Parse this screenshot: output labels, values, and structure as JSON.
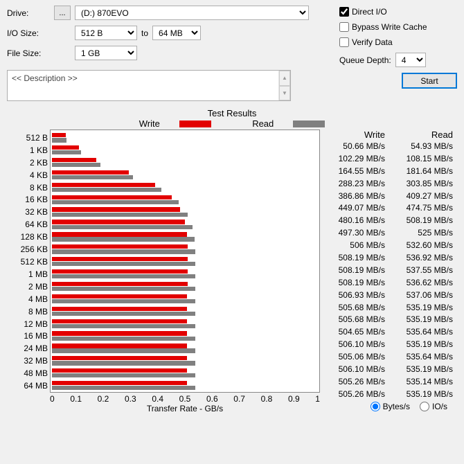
{
  "labels": {
    "drive": "Drive:",
    "iosize": "I/O Size:",
    "filesize": "File Size:",
    "to": "to",
    "direct_io": "Direct I/O",
    "bypass": "Bypass Write Cache",
    "verify": "Verify Data",
    "queue_depth": "Queue Depth:",
    "start": "Start",
    "description": "<< Description >>",
    "browse": "...",
    "results_title": "Test Results",
    "legend_write": "Write",
    "legend_read": "Read",
    "xlabel": "Transfer Rate - GB/s",
    "col_write": "Write",
    "col_read": "Read",
    "unit_bytes": "Bytes/s",
    "unit_ios": "IO/s"
  },
  "controls": {
    "drive_value": "(D:) 870EVO",
    "io_from": "512 B",
    "io_to": "64 MB",
    "file_size": "1 GB",
    "direct_io_checked": true,
    "bypass_checked": false,
    "verify_checked": false,
    "queue_depth": "4",
    "unit_selected": "bytes"
  },
  "chart_data": {
    "type": "bar",
    "orientation": "horizontal",
    "xlabel": "Transfer Rate - GB/s",
    "xlim": [
      0,
      1
    ],
    "xticks": [
      0,
      0.1,
      0.2,
      0.3,
      0.4,
      0.5,
      0.6,
      0.7,
      0.8,
      0.9,
      1
    ],
    "categories": [
      "512 B",
      "1 KB",
      "2 KB",
      "4 KB",
      "8 KB",
      "16 KB",
      "32 KB",
      "64 KB",
      "128 KB",
      "256 KB",
      "512 KB",
      "1 MB",
      "2 MB",
      "4 MB",
      "8 MB",
      "12 MB",
      "16 MB",
      "24 MB",
      "32 MB",
      "48 MB",
      "64 MB"
    ],
    "series": [
      {
        "name": "Write",
        "color": "#e20000",
        "values": [
          50.66,
          102.29,
          164.55,
          288.23,
          386.86,
          449.07,
          480.16,
          497.3,
          506,
          508.19,
          508.19,
          508.19,
          506.93,
          505.68,
          505.68,
          504.65,
          506.1,
          505.06,
          506.1,
          505.26,
          505.26
        ]
      },
      {
        "name": "Read",
        "color": "#808080",
        "values": [
          54.93,
          108.15,
          181.64,
          303.85,
          409.27,
          474.75,
          508.19,
          525,
          532.6,
          536.92,
          537.55,
          536.62,
          537.06,
          535.19,
          535.19,
          535.64,
          535.19,
          535.64,
          535.19,
          535.14,
          535.19
        ]
      }
    ],
    "value_unit": "MB/s",
    "bar_scale_max_mb": 1000
  },
  "table": [
    {
      "size": "512 B",
      "write": "50.66 MB/s",
      "read": "54.93 MB/s"
    },
    {
      "size": "1 KB",
      "write": "102.29 MB/s",
      "read": "108.15 MB/s"
    },
    {
      "size": "2 KB",
      "write": "164.55 MB/s",
      "read": "181.64 MB/s"
    },
    {
      "size": "4 KB",
      "write": "288.23 MB/s",
      "read": "303.85 MB/s"
    },
    {
      "size": "8 KB",
      "write": "386.86 MB/s",
      "read": "409.27 MB/s"
    },
    {
      "size": "16 KB",
      "write": "449.07 MB/s",
      "read": "474.75 MB/s"
    },
    {
      "size": "32 KB",
      "write": "480.16 MB/s",
      "read": "508.19 MB/s"
    },
    {
      "size": "64 KB",
      "write": "497.30 MB/s",
      "read": "525 MB/s"
    },
    {
      "size": "128 KB",
      "write": "506 MB/s",
      "read": "532.60 MB/s"
    },
    {
      "size": "256 KB",
      "write": "508.19 MB/s",
      "read": "536.92 MB/s"
    },
    {
      "size": "512 KB",
      "write": "508.19 MB/s",
      "read": "537.55 MB/s"
    },
    {
      "size": "1 MB",
      "write": "508.19 MB/s",
      "read": "536.62 MB/s"
    },
    {
      "size": "2 MB",
      "write": "506.93 MB/s",
      "read": "537.06 MB/s"
    },
    {
      "size": "4 MB",
      "write": "505.68 MB/s",
      "read": "535.19 MB/s"
    },
    {
      "size": "8 MB",
      "write": "505.68 MB/s",
      "read": "535.19 MB/s"
    },
    {
      "size": "12 MB",
      "write": "504.65 MB/s",
      "read": "535.64 MB/s"
    },
    {
      "size": "16 MB",
      "write": "506.10 MB/s",
      "read": "535.19 MB/s"
    },
    {
      "size": "24 MB",
      "write": "505.06 MB/s",
      "read": "535.64 MB/s"
    },
    {
      "size": "32 MB",
      "write": "506.10 MB/s",
      "read": "535.19 MB/s"
    },
    {
      "size": "48 MB",
      "write": "505.26 MB/s",
      "read": "535.14 MB/s"
    },
    {
      "size": "64 MB",
      "write": "505.26 MB/s",
      "read": "535.19 MB/s"
    }
  ]
}
